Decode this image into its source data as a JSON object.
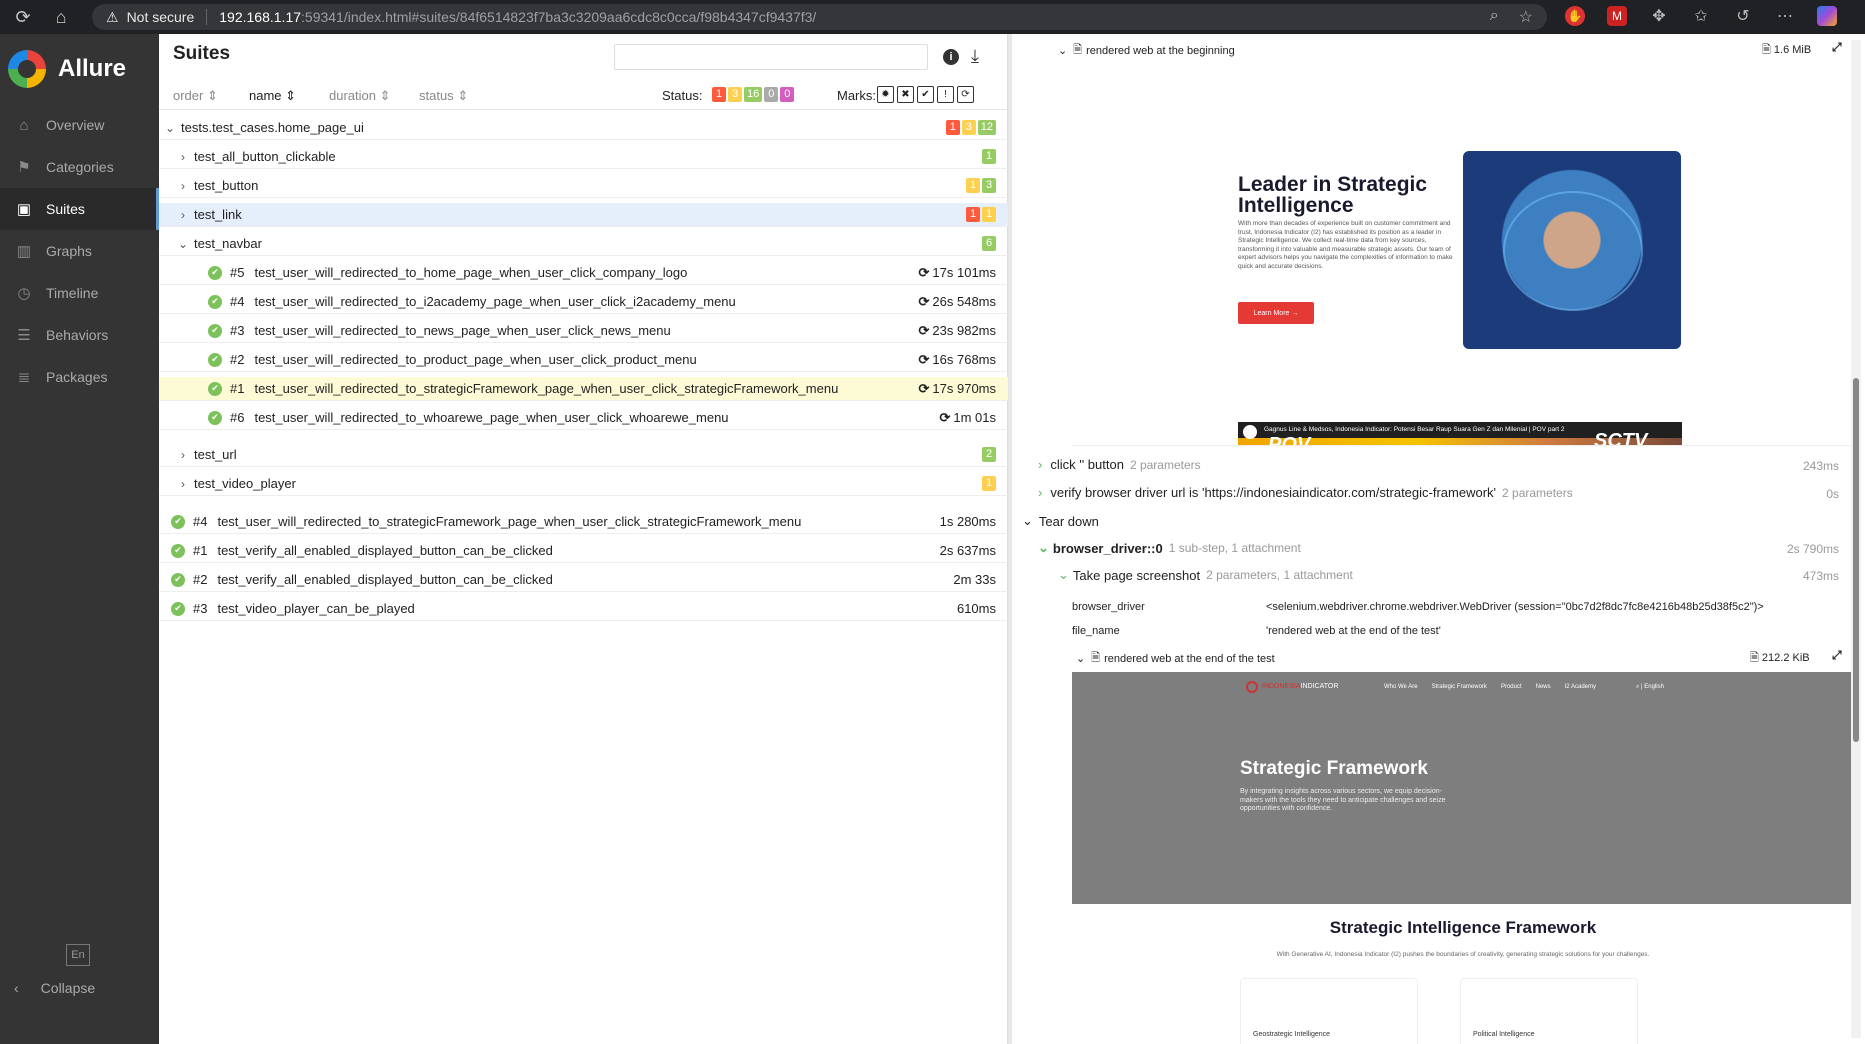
{
  "browser": {
    "not_secure": "Not secure",
    "url_host": "192.168.1.17",
    "url_path": ":59341/index.html#suites/84f6514823f7ba3c3209aa6cdc8c0cca/f98b4347cf9437f3/"
  },
  "sidebar": {
    "logo": "Allure",
    "items": [
      {
        "label": "Overview",
        "icon": "home-icon"
      },
      {
        "label": "Categories",
        "icon": "flag-icon"
      },
      {
        "label": "Suites",
        "icon": "briefcase-icon"
      },
      {
        "label": "Graphs",
        "icon": "bar-chart-icon"
      },
      {
        "label": "Timeline",
        "icon": "clock-icon"
      },
      {
        "label": "Behaviors",
        "icon": "list-icon"
      },
      {
        "label": "Packages",
        "icon": "packages-icon"
      }
    ],
    "lang": "En",
    "collapse": "Collapse"
  },
  "suites": {
    "title": "Suites",
    "sort": {
      "order": "order",
      "name": "name",
      "duration": "duration",
      "status": "status"
    },
    "status_label": "Status:",
    "status_counts": [
      "1",
      "3",
      "16",
      "0",
      "0"
    ],
    "marks_label": "Marks:",
    "root": {
      "name": "tests.test_cases.home_page_ui",
      "badges": [
        "1",
        "3",
        "12"
      ]
    },
    "groups": [
      {
        "name": "test_all_button_clickable",
        "badges": [
          "1"
        ]
      },
      {
        "name": "test_button",
        "badges": [
          "1",
          "3"
        ]
      },
      {
        "name": "test_link",
        "badges": [
          "1",
          "1"
        ]
      },
      {
        "name": "test_navbar",
        "badges": [
          "6"
        ]
      }
    ],
    "navbar_tests": [
      {
        "num": "#5",
        "name": "test_user_will_redirected_to_home_page_when_user_click_company_logo",
        "dur": "17s 101ms"
      },
      {
        "num": "#4",
        "name": "test_user_will_redirected_to_i2academy_page_when_user_click_i2academy_menu",
        "dur": "26s 548ms"
      },
      {
        "num": "#3",
        "name": "test_user_will_redirected_to_news_page_when_user_click_news_menu",
        "dur": "23s 982ms"
      },
      {
        "num": "#2",
        "name": "test_user_will_redirected_to_product_page_when_user_click_product_menu",
        "dur": "16s 768ms"
      },
      {
        "num": "#1",
        "name": "test_user_will_redirected_to_strategicFramework_page_when_user_click_strategicFramework_menu",
        "dur": "17s 970ms"
      },
      {
        "num": "#6",
        "name": "test_user_will_redirected_to_whoarewe_page_when_user_click_whoarewe_menu",
        "dur": "1m 01s"
      }
    ],
    "groups2": [
      {
        "name": "test_url",
        "badges": [
          "2"
        ]
      },
      {
        "name": "test_video_player",
        "badges": [
          "1"
        ]
      }
    ],
    "root_tests": [
      {
        "num": "#4",
        "name": "test_user_will_redirected_to_strategicFramework_page_when_user_click_strategicFramework_menu",
        "dur": "1s 280ms"
      },
      {
        "num": "#1",
        "name": "test_verify_all_enabled_displayed_button_can_be_clicked",
        "dur": "2s 637ms"
      },
      {
        "num": "#2",
        "name": "test_verify_all_enabled_displayed_button_can_be_clicked",
        "dur": "2m 33s"
      },
      {
        "num": "#3",
        "name": "test_video_player_can_be_played",
        "dur": "610ms"
      }
    ]
  },
  "detail": {
    "att1": {
      "name": "rendered web at the beginning",
      "size": "1.6 MiB"
    },
    "shot1": {
      "heading": "Leader in Strategic Intelligence",
      "body": "With more than decades of experience built on customer commitment and trust, Indonesia Indicator (I2) has established its position as a leader in Strategic Intelligence. We collect real-time data from key sources, transforming it into valuable and measurable strategic assets. Our team of expert advisors helps you navigate the complexities of information to make quick and accurate decisions.",
      "button": "Learn More →",
      "video_title": "Gagnus Line & Medsos, Indonesia Indicator: Potensi Besar Raup Suara Gen Z dan Milenial | POV part 2",
      "video_pov": "POV",
      "video_brand": "SCTV"
    },
    "steps": [
      {
        "label": "click '' button",
        "params": "2 parameters",
        "dur": "243ms"
      },
      {
        "label": "verify browser driver url is 'https://indonesiaindicator.com/strategic-framework'",
        "params": "2 parameters",
        "dur": "0s"
      }
    ],
    "teardown": "Tear down",
    "fixture": {
      "label": "browser_driver::0",
      "params": "1 sub-step, 1 attachment",
      "dur": "2s 790ms"
    },
    "substep": {
      "label": "Take page screenshot",
      "params": "2 parameters, 1 attachment",
      "dur": "473ms"
    },
    "param_rows": [
      {
        "name": "browser_driver",
        "value": "<selenium.webdriver.chrome.webdriver.WebDriver (session=\"0bc7d2f8dc7fc8e4216b48b25d38f5c2\")>"
      },
      {
        "name": "file_name",
        "value": "'rendered web at the end of the test'"
      }
    ],
    "att2": {
      "name": "rendered web at the end of the test",
      "size": "212.2 KiB"
    },
    "shot2": {
      "brand_a": "INDONESIA",
      "brand_b": "INDICATOR",
      "nav": [
        "Who We Are",
        "Strategic Framework",
        "Product",
        "News",
        "I2 Academy"
      ],
      "lang": "English",
      "hero_title": "Strategic Framework",
      "hero_body": "By integrating insights across various sectors, we equip decision-makers with the tools they need to anticipate challenges and seize opportunities with confidence.",
      "section_title": "Strategic Intelligence Framework",
      "section_body": "With Generative AI, Indonesia Indicator (I2) pushes the boundaries of creativity, generating strategic solutions for your challenges.",
      "card1": "Geostrategic Intelligence",
      "card2": "Political Intelligence"
    }
  }
}
